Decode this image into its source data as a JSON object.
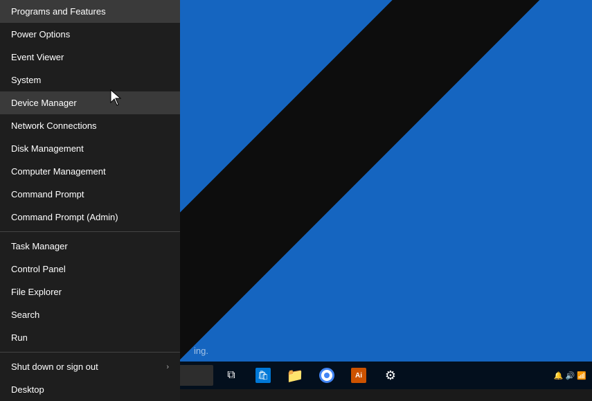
{
  "desktop": {
    "background_color": "#1565c0"
  },
  "context_menu": {
    "items": [
      {
        "id": "programs-features",
        "label": "Programs and Features",
        "divider_after": false
      },
      {
        "id": "power-options",
        "label": "Power Options",
        "divider_after": false
      },
      {
        "id": "event-viewer",
        "label": "Event Viewer",
        "divider_after": false
      },
      {
        "id": "system",
        "label": "System",
        "divider_after": false
      },
      {
        "id": "device-manager",
        "label": "Device Manager",
        "highlighted": true,
        "divider_after": false
      },
      {
        "id": "network-connections",
        "label": "Network Connections",
        "divider_after": false
      },
      {
        "id": "disk-management",
        "label": "Disk Management",
        "divider_after": false
      },
      {
        "id": "computer-management",
        "label": "Computer Management",
        "divider_after": false
      },
      {
        "id": "command-prompt",
        "label": "Command Prompt",
        "divider_after": false
      },
      {
        "id": "command-prompt-admin",
        "label": "Command Prompt (Admin)",
        "divider_after": true
      },
      {
        "id": "task-manager",
        "label": "Task Manager",
        "divider_after": false
      },
      {
        "id": "control-panel",
        "label": "Control Panel",
        "divider_after": false
      },
      {
        "id": "file-explorer",
        "label": "File Explorer",
        "divider_after": false
      },
      {
        "id": "search",
        "label": "Search",
        "divider_after": false
      },
      {
        "id": "run",
        "label": "Run",
        "divider_after": true
      },
      {
        "id": "shut-down",
        "label": "Shut down or sign out",
        "has_arrow": true,
        "divider_after": false
      },
      {
        "id": "desktop",
        "label": "Desktop",
        "divider_after": false
      }
    ]
  },
  "taskbar": {
    "start_icon": "⊞",
    "search_placeholder": "ing.",
    "apps": [
      {
        "id": "task-view",
        "icon": "⧉",
        "color": "white"
      },
      {
        "id": "store",
        "icon": "🛍",
        "color": "#0078d7"
      },
      {
        "id": "files",
        "icon": "📁",
        "color": "#f0a500"
      },
      {
        "id": "chrome",
        "icon": "●",
        "color": "#4285f4"
      },
      {
        "id": "illustrator",
        "icon": "Ai",
        "color": "#cc5200"
      },
      {
        "id": "settings",
        "icon": "⚙",
        "color": "white"
      }
    ]
  }
}
